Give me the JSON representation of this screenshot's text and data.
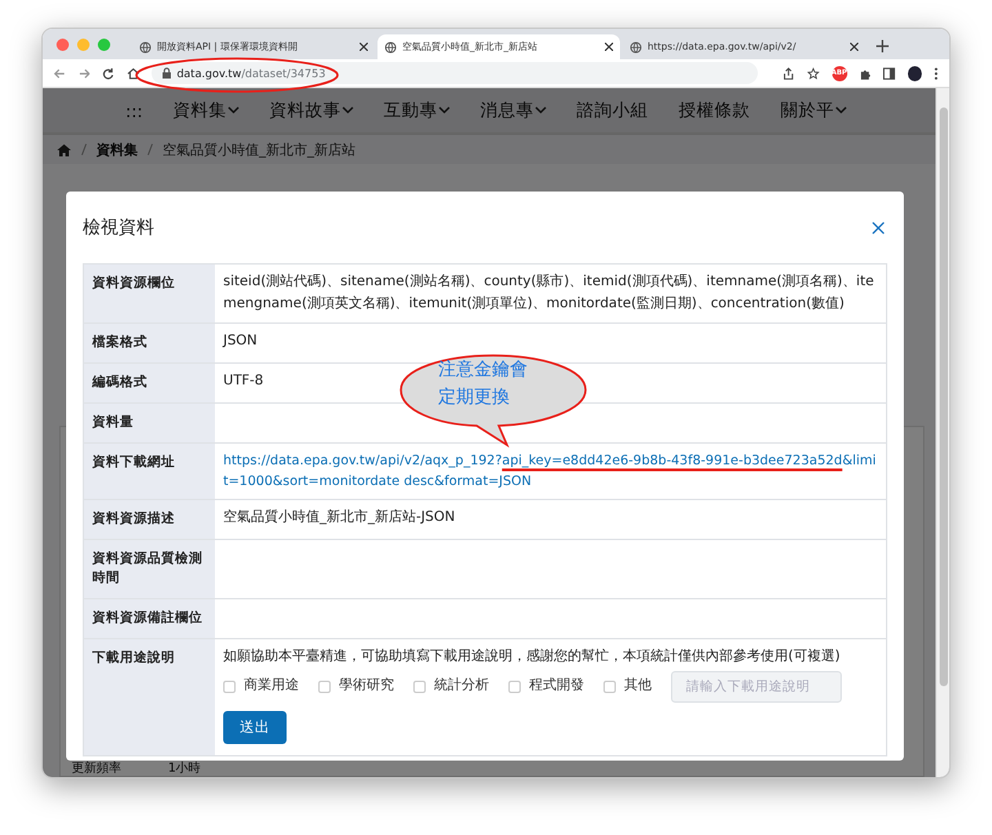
{
  "browser": {
    "tabs": [
      {
        "title": "開放資料API | 環保署環境資料開",
        "selected": false
      },
      {
        "title": "空氣品質小時值_新北市_新店站",
        "selected": true
      },
      {
        "title": "https://data.epa.gov.tw/api/v2/",
        "selected": false
      }
    ],
    "address": {
      "host": "data.gov.tw",
      "path": "/dataset/34753"
    },
    "extension_badge": "ABP"
  },
  "nav": {
    "items": [
      {
        "label": ":::",
        "dropdown": false
      },
      {
        "label": "資料集",
        "dropdown": true
      },
      {
        "label": "資料故事",
        "dropdown": true
      },
      {
        "label": "互動專",
        "dropdown": true
      },
      {
        "label": "消息專",
        "dropdown": true
      },
      {
        "label": "諮詢小組",
        "dropdown": false
      },
      {
        "label": "授權條款",
        "dropdown": false
      },
      {
        "label": "關於平",
        "dropdown": true
      }
    ]
  },
  "breadcrumb": [
    "資料集",
    "空氣品質小時值_新北市_新店站"
  ],
  "background_row": {
    "label": "更新頻率",
    "value": "1小時"
  },
  "modal": {
    "title": "檢視資料",
    "rows": [
      {
        "kind": "text",
        "label": "資料資源欄位",
        "value": "siteid(測站代碼)、sitename(測站名稱)、county(縣市)、itemid(測項代碼)、itemname(測項名稱)、itemengname(測項英文名稱)、itemunit(測項單位)、monitordate(監測日期)、concentration(數值)"
      },
      {
        "kind": "text",
        "label": "檔案格式",
        "value": "JSON"
      },
      {
        "kind": "text",
        "label": "編碼格式",
        "value": "UTF-8"
      },
      {
        "kind": "text",
        "label": "資料量",
        "value": ""
      },
      {
        "kind": "link",
        "label": "資料下載網址",
        "before": "https://data.epa.gov.tw/api/v2/aqx_p_192?",
        "marked": "api_key=e8dd42e6-9b8b-43f8-991e-b3dee723a52d",
        "after": "&limit=1000&sort=monitordate desc&format=JSON"
      },
      {
        "kind": "text",
        "label": "資料資源描述",
        "value": "空氣品質小時值_新北市_新店站-JSON"
      },
      {
        "kind": "text",
        "label": "資料資源品質檢測時間",
        "value": ""
      },
      {
        "kind": "text",
        "label": "資料資源備註欄位",
        "value": ""
      },
      {
        "kind": "form",
        "label": "下載用途說明",
        "intro": "如願協助本平臺精進，可協助填寫下載用途說明，感謝您的幫忙，本項統計僅供內部參考使用(可複選)",
        "options": [
          {
            "label": "商業用途",
            "checked": false
          },
          {
            "label": "學術研究",
            "checked": false
          },
          {
            "label": "統計分析",
            "checked": false
          },
          {
            "label": "程式開發",
            "checked": false
          },
          {
            "label": "其他",
            "checked": false
          }
        ],
        "other_placeholder": "請輸入下載用途說明",
        "submit": "送出"
      }
    ]
  },
  "callout": {
    "lines": [
      "注意金鑰會",
      "定期更換"
    ]
  }
}
